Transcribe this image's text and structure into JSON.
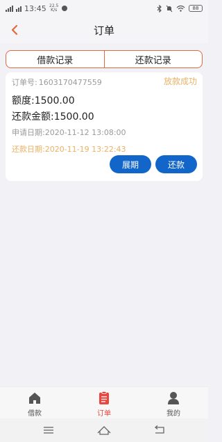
{
  "status_bar": {
    "time": "13:45",
    "net_speed": "22.5 K/s",
    "battery": "88"
  },
  "header": {
    "title": "订单"
  },
  "tabs": [
    {
      "label": "借款记录"
    },
    {
      "label": "还款记录"
    }
  ],
  "order": {
    "number_label": "订单号:",
    "number": "1603170477559",
    "status": "放款成功",
    "amount_label": "额度:",
    "amount": "1500.00",
    "repay_label": "还款金额:",
    "repay_amount": "1500.00",
    "apply_label": "申请日期:",
    "apply_date": "2020-11-12 13:08:00",
    "due_label": "还款日期:",
    "due_date": "2020-11-19 13:22:43",
    "extend_button": "展期",
    "repay_button": "还款"
  },
  "tabbar": [
    {
      "label": "借款",
      "icon": "home-icon",
      "active": false
    },
    {
      "label": "订单",
      "icon": "order-clipboard-icon",
      "active": true
    },
    {
      "label": "我的",
      "icon": "user-icon",
      "active": false
    }
  ],
  "colors": {
    "accent": "#e06a3f",
    "status": "#e9b266",
    "primary_button": "#1366c9",
    "active_tab": "#e8463f"
  }
}
